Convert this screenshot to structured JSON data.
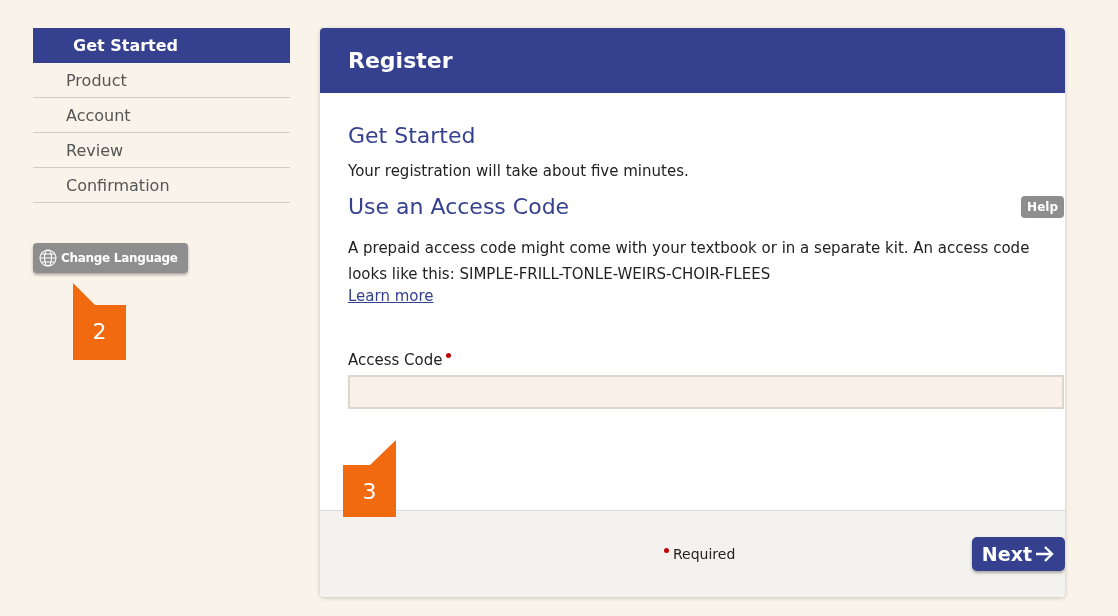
{
  "sidebar": {
    "steps": [
      {
        "label": "Get Started",
        "selected": true
      },
      {
        "label": "Product",
        "selected": false
      },
      {
        "label": "Account",
        "selected": false
      },
      {
        "label": "Review",
        "selected": false
      },
      {
        "label": "Confirmation",
        "selected": false
      }
    ],
    "language_button": "Change Language"
  },
  "panel": {
    "title": "Register",
    "heading": "Get Started",
    "intro": "Your registration will take about five minutes.",
    "section_title": "Use an Access Code",
    "help_button": "Help",
    "description": "A prepaid access code might come with your textbook or in a separate kit. An access code looks like this: SIMPLE-FRILL-TONLE-WEIRS-CHOIR-FLEES",
    "learn_more": "Learn more",
    "field": {
      "label": "Access Code",
      "required": true
    },
    "footer": {
      "required_note": "Required",
      "next_button": "Next"
    }
  },
  "callouts": [
    {
      "number": "2"
    },
    {
      "number": "3"
    }
  ]
}
